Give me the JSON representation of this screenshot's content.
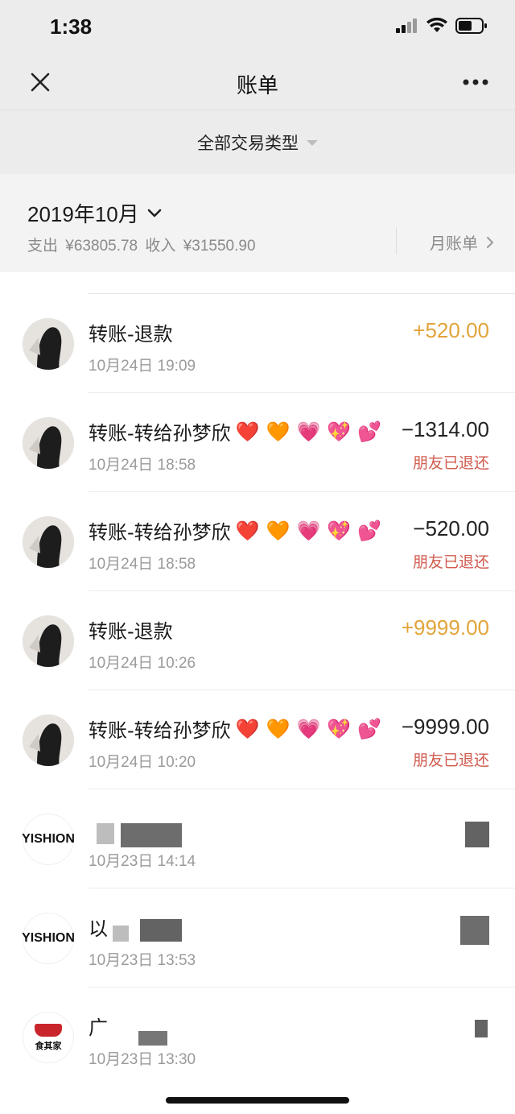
{
  "status_bar": {
    "time": "1:38"
  },
  "nav": {
    "title": "账单"
  },
  "filter": {
    "label": "全部交易类型"
  },
  "month": {
    "label": "2019年10月",
    "expense_label": "支出",
    "expense": "¥63805.78",
    "income_label": "收入",
    "income": "¥31550.90",
    "monthly_bill_label": "月账单"
  },
  "transactions": [
    {
      "title": "转账-退款",
      "hearts": [],
      "time": "10月24日 19:09",
      "amount": "+520.00",
      "status": ""
    },
    {
      "title": "转账-转给孙梦欣",
      "hearts": [
        "❤️",
        "🧡",
        "💗",
        "💖",
        "💕"
      ],
      "time": "10月24日 18:58",
      "amount": "−1314.00",
      "status": "朋友已退还"
    },
    {
      "title": "转账-转给孙梦欣",
      "hearts": [
        "❤️",
        "🧡",
        "💗",
        "💖",
        "💕"
      ],
      "time": "10月24日 18:58",
      "amount": "−520.00",
      "status": "朋友已退还"
    },
    {
      "title": "转账-退款",
      "hearts": [],
      "time": "10月24日 10:26",
      "amount": "+9999.00",
      "status": ""
    },
    {
      "title": "转账-转给孙梦欣",
      "hearts": [
        "❤️",
        "🧡",
        "💗",
        "💖",
        "💕"
      ],
      "time": "10月24日 10:20",
      "amount": "−9999.00",
      "status": "朋友已退还"
    },
    {
      "title": "",
      "time": "10月23日 14:14",
      "logo": "YISHION"
    },
    {
      "title": "以",
      "time": "10月23日 13:53",
      "logo": "YISHION"
    },
    {
      "title": "广",
      "time": "10月23日 13:30",
      "logo": "食其家"
    }
  ],
  "colors": {
    "income": "#e2a43a",
    "refund_status": "#d05b4f",
    "muted": "#9a9a9a"
  }
}
